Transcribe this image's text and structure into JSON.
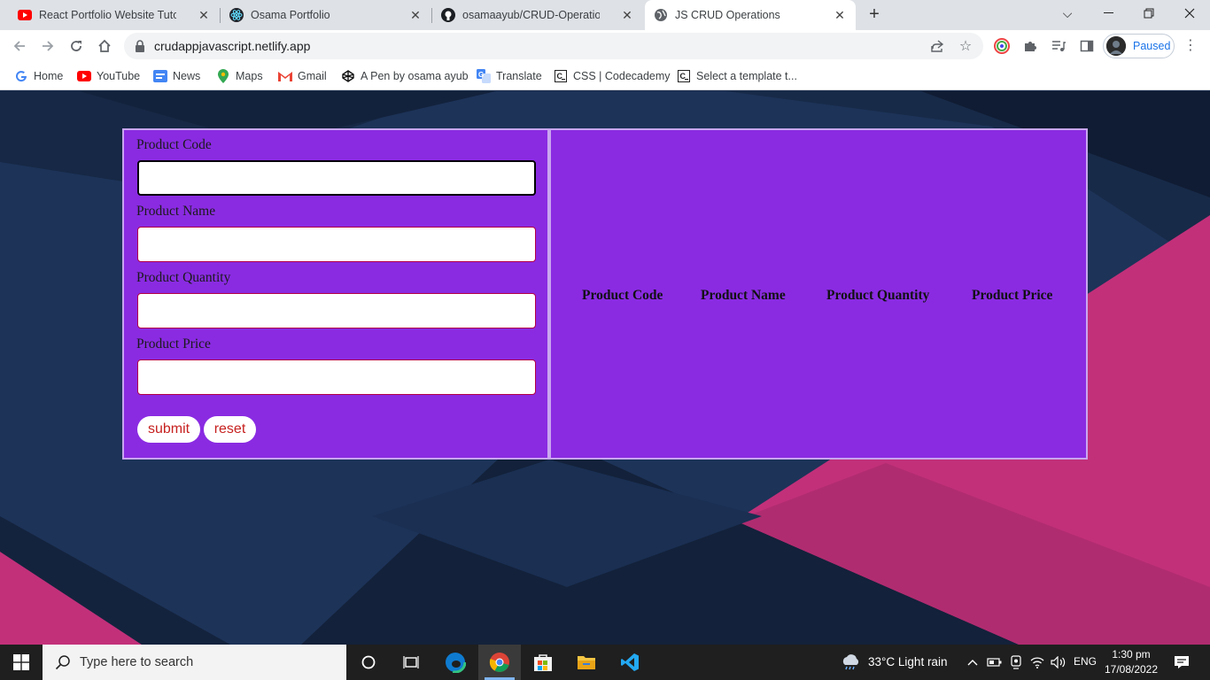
{
  "browser": {
    "tabs": [
      {
        "title": "React Portfolio Website Tutorial F",
        "icon": "youtube-icon",
        "active": false
      },
      {
        "title": "Osama Portfolio",
        "icon": "react-icon",
        "active": false
      },
      {
        "title": "osamaayub/CRUD-Operation-Ap",
        "icon": "github-icon",
        "active": false
      },
      {
        "title": "JS CRUD Operations",
        "icon": "globe-icon",
        "active": true
      }
    ],
    "url": "crudappjavascript.netlify.app",
    "profile_status": "Paused",
    "bookmarks": [
      {
        "label": "Home",
        "icon": "google-icon"
      },
      {
        "label": "YouTube",
        "icon": "youtube-icon"
      },
      {
        "label": "News",
        "icon": "news-icon"
      },
      {
        "label": "Maps",
        "icon": "maps-icon"
      },
      {
        "label": "Gmail",
        "icon": "gmail-icon"
      },
      {
        "label": "A Pen by osama ayub",
        "icon": "codepen-icon"
      },
      {
        "label": "Translate",
        "icon": "translate-icon"
      },
      {
        "label": "CSS | Codecademy",
        "icon": "codecademy-icon"
      },
      {
        "label": "Select a template t...",
        "icon": "codecademy-icon"
      }
    ]
  },
  "page": {
    "form": {
      "fields": [
        {
          "label": "Product Code",
          "value": ""
        },
        {
          "label": "Product Name",
          "value": ""
        },
        {
          "label": "Product Quantity",
          "value": ""
        },
        {
          "label": "Product Price",
          "value": ""
        }
      ],
      "submit_label": "submit",
      "reset_label": "reset"
    },
    "table": {
      "headers": [
        "Product Code",
        "Product Name",
        "Product Quantity",
        "Product Price"
      ],
      "rows": []
    }
  },
  "taskbar": {
    "search_placeholder": "Type here to search",
    "weather": "33°C  Light rain",
    "language": "ENG",
    "time": "1:30 pm",
    "date": "17/08/2022"
  },
  "colors": {
    "panel": "#8a2be2",
    "button_text": "#c6211f",
    "background": "#1d3358",
    "accent_pink": "#c2307a"
  }
}
